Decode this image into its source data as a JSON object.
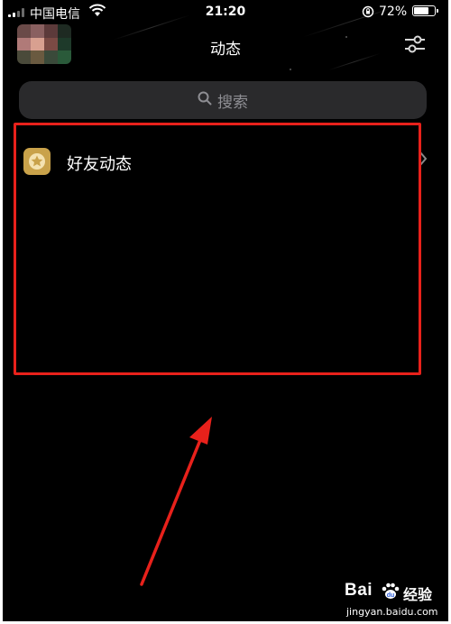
{
  "status_bar": {
    "carrier": "中国电信",
    "time": "21:20",
    "battery_percent": "72%",
    "battery_level": 0.72,
    "signal_bars": 4,
    "signal_active": 2
  },
  "header": {
    "title": "动态",
    "filter_icon": "sliders-icon",
    "avatar_colors": [
      "#6a4a48",
      "#8a6060",
      "#5c3a3a",
      "#1e2a22",
      "#b07a78",
      "#d8a090",
      "#7a4a44",
      "#1e3a2a",
      "#4a4a3a",
      "#6a5a40",
      "#3a4a3a",
      "#2a5a3a"
    ]
  },
  "search": {
    "placeholder": "搜索",
    "icon": "search-icon"
  },
  "feed": {
    "items": [
      {
        "label": "好友动态",
        "icon": "star-badge-icon",
        "icon_color": "#c9a24a"
      }
    ]
  },
  "annotation": {
    "highlight_color": "#e8211b",
    "arrow_color": "#e8211b"
  },
  "watermark": {
    "brand": "Bai",
    "brand_suffix": "经验",
    "url": "jingyan.baidu.com"
  }
}
